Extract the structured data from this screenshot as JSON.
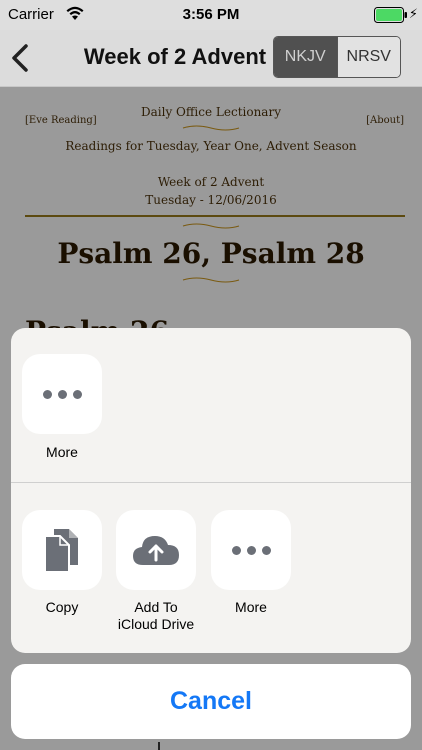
{
  "status": {
    "carrier": "Carrier",
    "time": "3:56 PM"
  },
  "nav": {
    "title": "Week of 2 Advent",
    "translations": [
      "NKJV",
      "NRSV"
    ]
  },
  "content": {
    "eve_link": "[Eve Reading]",
    "about_link": "[About]",
    "lectionary_title": "Daily Office Lectionary",
    "subtitle": "Readings for Tuesday, Year One, Advent Season",
    "week": "Week of 2 Advent",
    "date": "Tuesday - 12/06/2016",
    "psalm_title": "Psalm 26, Psalm 28",
    "psalm_heading": "Psalm 26"
  },
  "sheet": {
    "top_row": [
      {
        "label": "More",
        "icon": "more-dots-icon"
      }
    ],
    "bottom_row": [
      {
        "label": "Copy",
        "icon": "copy-documents-icon"
      },
      {
        "label": "Add To\niCloud Drive",
        "icon": "icloud-upload-icon"
      },
      {
        "label": "More",
        "icon": "more-dots-icon"
      }
    ],
    "cancel": "Cancel"
  },
  "colors": {
    "accent": "#1478f6",
    "battery": "#4cd964",
    "icon_gray": "#6b6f77"
  }
}
